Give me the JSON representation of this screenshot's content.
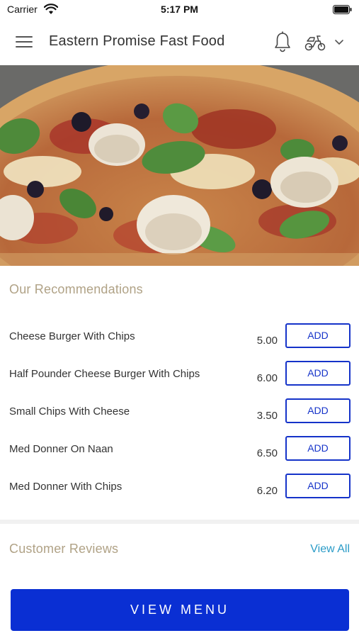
{
  "status_bar": {
    "carrier": "Carrier",
    "time": "5:17 PM",
    "wifi_icon": "wifi-icon",
    "battery_icon": "battery-icon"
  },
  "header": {
    "title": "Eastern Promise Fast Food",
    "menu_icon": "hamburger-menu-icon",
    "notification_icon": "bell-icon",
    "delivery_icon": "delivery-scooter-icon",
    "dropdown_icon": "chevron-down-icon"
  },
  "hero": {
    "image": "pizza-image"
  },
  "recommendations": {
    "title": "Our Recommendations",
    "items": [
      {
        "name": "Cheese Burger With Chips",
        "price": "5.00",
        "action": "ADD"
      },
      {
        "name": "Half Pounder Cheese Burger With Chips",
        "price": "6.00",
        "action": "ADD"
      },
      {
        "name": "Small Chips With Cheese",
        "price": "3.50",
        "action": "ADD"
      },
      {
        "name": "Med Donner On Naan",
        "price": "6.50",
        "action": "ADD"
      },
      {
        "name": "Med Donner With Chips",
        "price": "6.20",
        "action": "ADD"
      }
    ]
  },
  "reviews": {
    "title": "Customer Reviews",
    "view_all": "View All"
  },
  "footer": {
    "view_menu": "VIEW MENU"
  },
  "colors": {
    "accent_blue": "#1533c9",
    "button_blue": "#0a2fd3",
    "section_title": "#b0a286",
    "link": "#2a9bc7"
  }
}
